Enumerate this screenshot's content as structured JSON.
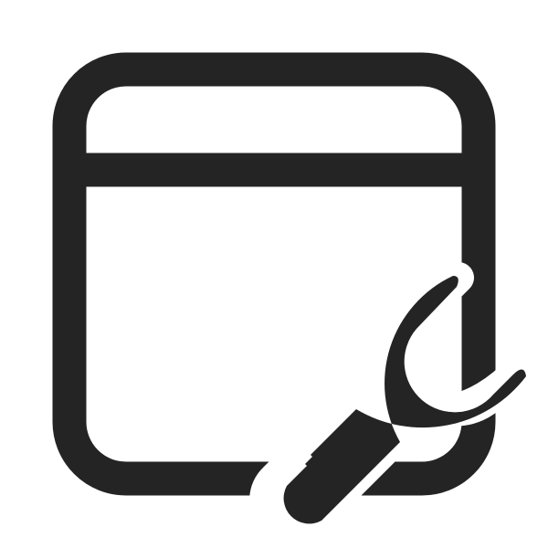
{
  "icon": {
    "name": "app-window-wrench-icon",
    "parts": [
      "window-frame-icon",
      "wrench-icon"
    ],
    "color": "#242424",
    "background": "#ffffff"
  }
}
